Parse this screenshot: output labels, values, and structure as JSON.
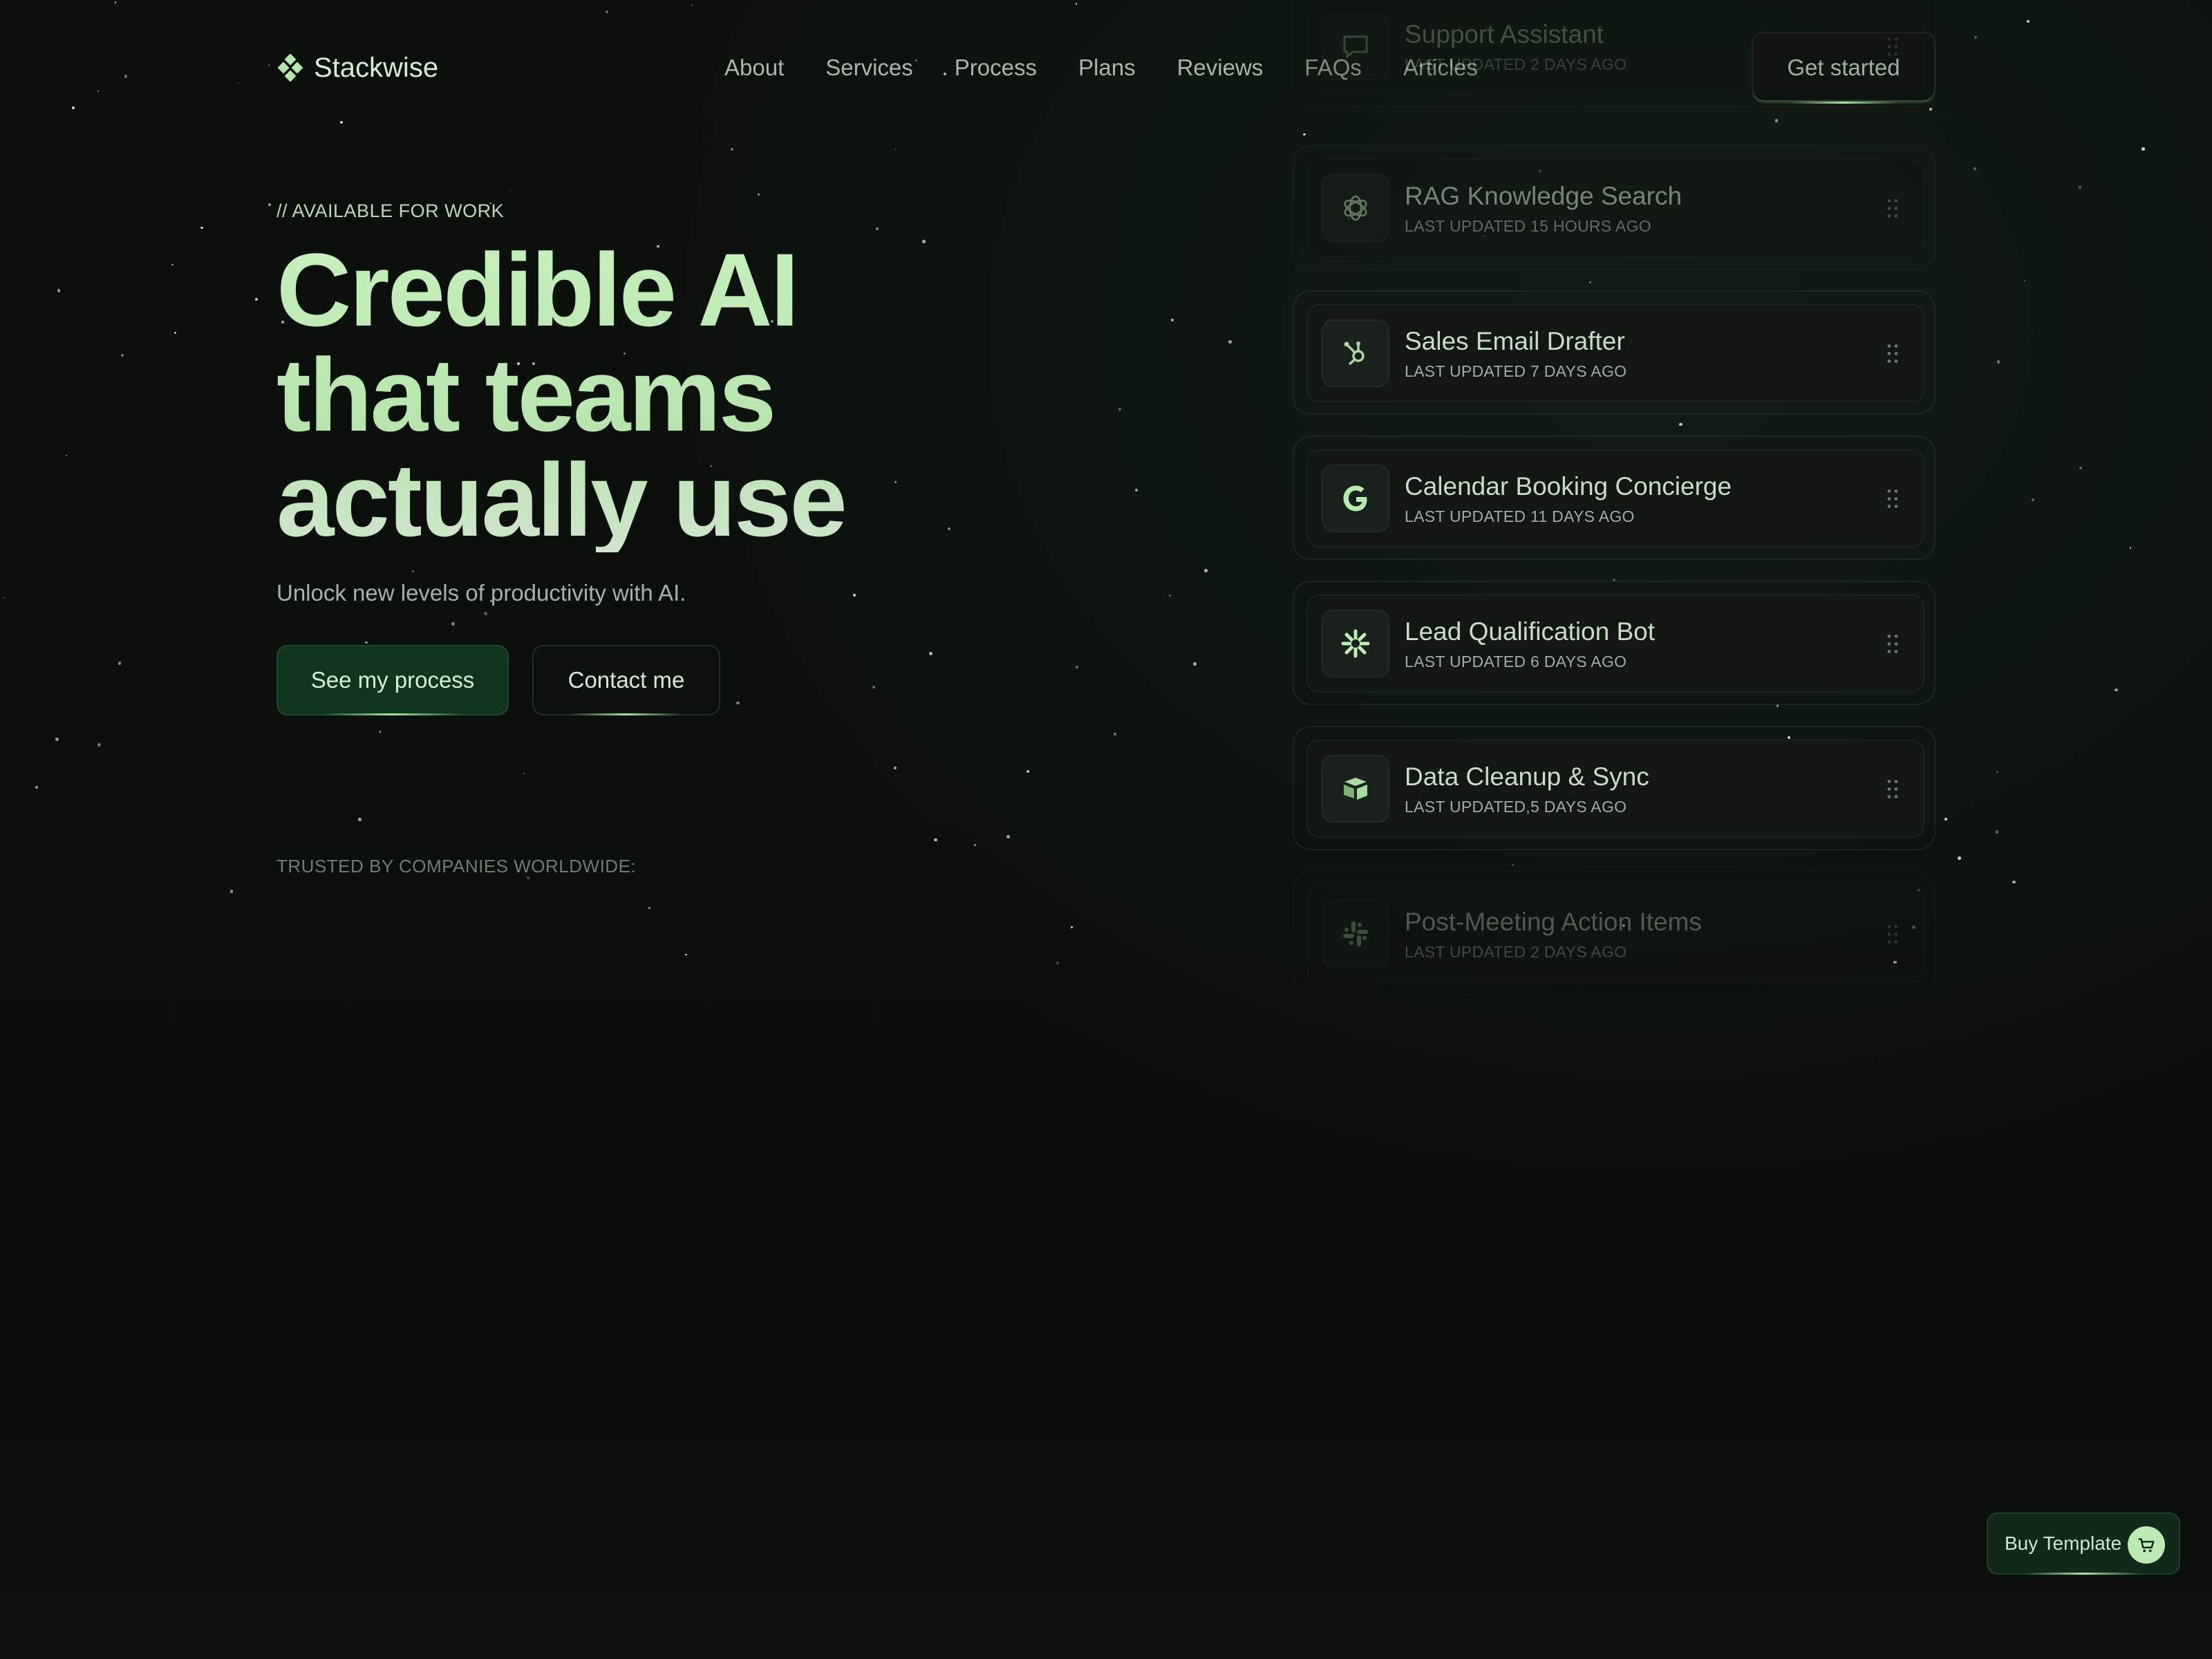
{
  "brand": {
    "name": "Stackwise",
    "logo_icon": "diamond-grid-icon"
  },
  "nav": {
    "links": [
      "About",
      "Services",
      "Process",
      "Plans",
      "Reviews",
      "FAQs",
      "Articles"
    ],
    "cta": "Get started"
  },
  "hero": {
    "eyebrow": "// AVAILABLE FOR WORK",
    "headline_lines": [
      "Credible AI",
      "that teams",
      "actually use"
    ],
    "subhead": "Unlock new levels of productivity with AI.",
    "primary_button": "See my process",
    "secondary_button": "Contact me",
    "trusted": "TRUSTED BY COMPANIES WORLDWIDE:"
  },
  "cards": [
    {
      "title": "Support Assistant",
      "subtitle": "LAST UPDATED 2 DAYS AGO",
      "icon": "chat-icon"
    },
    {
      "title": "RAG Knowledge Search",
      "subtitle": "LAST UPDATED 15 HOURS AGO",
      "icon": "openai-icon"
    },
    {
      "title": "Sales Email Drafter",
      "subtitle": "LAST UPDATED 7 DAYS AGO",
      "icon": "hubspot-icon"
    },
    {
      "title": "Calendar Booking Concierge",
      "subtitle": "LAST UPDATED 11 DAYS AGO",
      "icon": "google-icon"
    },
    {
      "title": "Lead Qualification Bot",
      "subtitle": "LAST UPDATED 6 DAYS AGO",
      "icon": "asterisk-icon"
    },
    {
      "title": "Data Cleanup & Sync",
      "subtitle": "LAST UPDATED,5 DAYS AGO",
      "icon": "airtable-icon"
    },
    {
      "title": "Post-Meeting Action Items",
      "subtitle": "LAST UPDATED 2 DAYS AGO",
      "icon": "slack-icon"
    }
  ],
  "buy_template": {
    "label": "Buy Template",
    "icon": "cart-icon"
  },
  "colors": {
    "background": "#0b0f0c",
    "accent": "#a8e6a0",
    "primary_button": "#12351d"
  }
}
